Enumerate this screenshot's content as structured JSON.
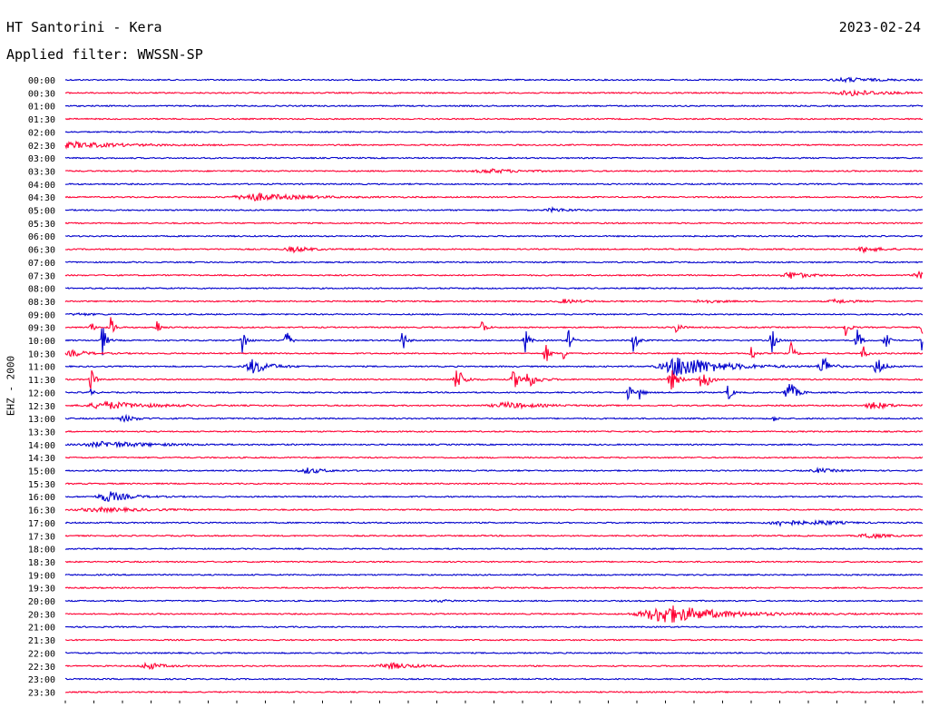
{
  "header": {
    "station": "HT Santorini - Kera",
    "date": "2023-02-24",
    "filter_label": "Applied filter: WWSSN-SP"
  },
  "axis": {
    "channel_label": "EHZ - 2000"
  },
  "colors": {
    "trace_even": "#0000cc",
    "trace_odd": "#ff0033",
    "background": "#ffffff",
    "text": "#000000"
  },
  "chart_data": {
    "type": "line",
    "title": "HT Santorini - Kera",
    "subtitle": "Applied filter: WWSSN-SP",
    "ylabel": "EHZ - 2000",
    "xlabel": "",
    "trace_minutes": 30,
    "x_range_minutes": [
      0,
      30
    ],
    "grid": false,
    "legend": "none",
    "rows": [
      {
        "label": "00:00",
        "events": [
          [
            27.4,
            2,
            1
          ]
        ]
      },
      {
        "label": "00:30",
        "events": [
          [
            27.6,
            3,
            1
          ]
        ]
      },
      {
        "label": "01:00",
        "events": []
      },
      {
        "label": "01:30",
        "events": []
      },
      {
        "label": "02:00",
        "events": []
      },
      {
        "label": "02:30",
        "events": [
          [
            0.4,
            3,
            1.5
          ]
        ]
      },
      {
        "label": "03:00",
        "events": []
      },
      {
        "label": "03:30",
        "events": [
          [
            14.9,
            2,
            1
          ]
        ]
      },
      {
        "label": "04:00",
        "events": []
      },
      {
        "label": "04:30",
        "events": [
          [
            6.7,
            4,
            1.3
          ]
        ]
      },
      {
        "label": "05:00",
        "events": [
          [
            17.1,
            2,
            0.5
          ]
        ]
      },
      {
        "label": "05:30",
        "events": []
      },
      {
        "label": "06:00",
        "events": []
      },
      {
        "label": "06:30",
        "events": [
          [
            8.0,
            3,
            0.5
          ],
          [
            28.0,
            3,
            0.5
          ]
        ]
      },
      {
        "label": "07:00",
        "events": []
      },
      {
        "label": "07:30",
        "events": [
          [
            25.4,
            4,
            0.5
          ],
          [
            30.0,
            4,
            0.5
          ]
        ]
      },
      {
        "label": "08:00",
        "events": []
      },
      {
        "label": "08:30",
        "events": [
          [
            17.5,
            2,
            0.5
          ],
          [
            22.3,
            2,
            0.5
          ],
          [
            27.0,
            2,
            0.5
          ]
        ]
      },
      {
        "label": "09:00",
        "events": [
          [
            0.5,
            1,
            0.5
          ]
        ]
      },
      {
        "label": "09:30",
        "events": [
          [
            0.9,
            6,
            0.1
          ],
          [
            1.6,
            12,
            0.1
          ],
          [
            3.2,
            10,
            0.1
          ],
          [
            14.6,
            10,
            0.1
          ],
          [
            21.4,
            10,
            0.1
          ],
          [
            27.3,
            12,
            0.1
          ],
          [
            30.0,
            12,
            0.1
          ]
        ]
      },
      {
        "label": "10:00",
        "events": [
          [
            1.3,
            20,
            0.1
          ],
          [
            6.2,
            18,
            0.1
          ],
          [
            7.7,
            20,
            0.1
          ],
          [
            11.8,
            14,
            0.1
          ],
          [
            16.1,
            14,
            0.1
          ],
          [
            17.6,
            14,
            0.1
          ],
          [
            19.9,
            18,
            0.1
          ],
          [
            24.7,
            18,
            0.1
          ],
          [
            27.7,
            16,
            0.1
          ],
          [
            28.7,
            18,
            0.1
          ],
          [
            30.0,
            16,
            0.1
          ]
        ]
      },
      {
        "label": "10:30",
        "events": [
          [
            0.3,
            3,
            0.5
          ],
          [
            16.8,
            14,
            0.1
          ],
          [
            17.4,
            10,
            0.1
          ],
          [
            24.0,
            10,
            0.1
          ],
          [
            25.4,
            12,
            0.1
          ],
          [
            27.9,
            10,
            0.1
          ]
        ]
      },
      {
        "label": "11:00",
        "events": [
          [
            6.6,
            8,
            0.5
          ],
          [
            21.6,
            12,
            1.2
          ],
          [
            26.5,
            14,
            0.2
          ],
          [
            28.4,
            10,
            0.2
          ]
        ]
      },
      {
        "label": "11:30",
        "events": [
          [
            0.9,
            14,
            0.1
          ],
          [
            13.7,
            14,
            0.2
          ],
          [
            15.7,
            10,
            0.2
          ],
          [
            16.2,
            8,
            0.3
          ],
          [
            21.2,
            12,
            0.2
          ],
          [
            22.3,
            14,
            0.2
          ]
        ]
      },
      {
        "label": "12:00",
        "events": [
          [
            0.9,
            4,
            0.1
          ],
          [
            19.7,
            10,
            0.1
          ],
          [
            20.1,
            8,
            0.1
          ],
          [
            23.2,
            12,
            0.1
          ],
          [
            25.3,
            16,
            0.2
          ]
        ]
      },
      {
        "label": "12:30",
        "events": [
          [
            1.5,
            4,
            1.3
          ],
          [
            15.5,
            3,
            1.0
          ],
          [
            28.3,
            4,
            0.5
          ]
        ]
      },
      {
        "label": "13:00",
        "events": [
          [
            2.1,
            3,
            0.4
          ],
          [
            24.8,
            3,
            0.1
          ]
        ]
      },
      {
        "label": "13:30",
        "events": []
      },
      {
        "label": "14:00",
        "events": [
          [
            1.5,
            3,
            1.5
          ]
        ]
      },
      {
        "label": "14:30",
        "events": []
      },
      {
        "label": "15:00",
        "events": [
          [
            8.5,
            3,
            0.5
          ],
          [
            26.4,
            2,
            0.5
          ]
        ]
      },
      {
        "label": "15:30",
        "events": []
      },
      {
        "label": "16:00",
        "events": [
          [
            1.5,
            6,
            0.6
          ]
        ]
      },
      {
        "label": "16:30",
        "events": [
          [
            1.3,
            2,
            1.5
          ]
        ]
      },
      {
        "label": "17:00",
        "events": [
          [
            25.1,
            3,
            0.8
          ],
          [
            26.5,
            2,
            0.5
          ]
        ]
      },
      {
        "label": "17:30",
        "events": [
          [
            28.1,
            3,
            0.5
          ]
        ]
      },
      {
        "label": "18:00",
        "events": []
      },
      {
        "label": "18:30",
        "events": []
      },
      {
        "label": "19:00",
        "events": []
      },
      {
        "label": "19:30",
        "events": []
      },
      {
        "label": "20:00",
        "events": [
          [
            13.1,
            1,
            0.5
          ]
        ]
      },
      {
        "label": "20:30",
        "events": [
          [
            21.1,
            10,
            1.6
          ]
        ]
      },
      {
        "label": "21:00",
        "events": []
      },
      {
        "label": "21:30",
        "events": []
      },
      {
        "label": "22:00",
        "events": []
      },
      {
        "label": "22:30",
        "events": [
          [
            2.9,
            4,
            0.4
          ],
          [
            11.4,
            3,
            0.8
          ]
        ]
      },
      {
        "label": "23:00",
        "events": []
      },
      {
        "label": "23:30",
        "events": []
      }
    ]
  }
}
